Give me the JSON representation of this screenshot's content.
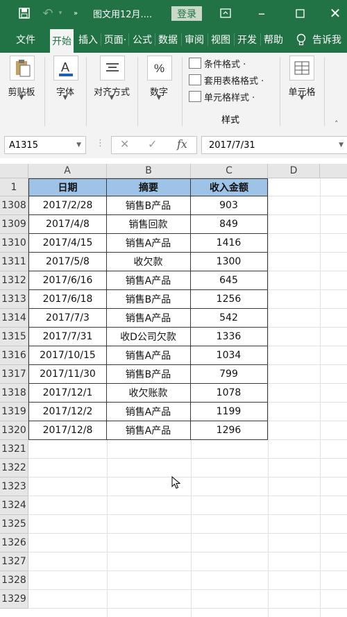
{
  "titlebar": {
    "save_icon": "save-icon",
    "undo_icon": "undo-icon",
    "more_icon": "customize-quick-access-icon",
    "title": "图文用12月....",
    "login": "登录",
    "icons": [
      "ribbon-display-options-icon",
      "minimize-icon",
      "maximize-icon",
      "close-icon"
    ],
    "bg_color": "#217346"
  },
  "tabs": [
    "文件",
    "开始",
    "插入",
    "页面·",
    "公式",
    "数据",
    "审阅",
    "视图",
    "开发",
    "帮助"
  ],
  "active_tab": "开始",
  "tell_me": "告诉我",
  "ribbon": {
    "clipboard": "剪贴板",
    "font": "字体",
    "alignment": "对齐方式",
    "number": "数字",
    "conditional": "条件格式 ·",
    "table_format": "套用表格格式 ·",
    "cell_styles": "单元格样式 ·",
    "styles_group": "样式",
    "cells": "单元格"
  },
  "formula_bar": {
    "name_box": "A1315",
    "formula": "2017/7/31",
    "cancel": "✕",
    "enter": "✓",
    "fx": "fx"
  },
  "columns": [
    "A",
    "B",
    "C",
    "D"
  ],
  "headers": [
    "日期",
    "摘要",
    "收入金额"
  ],
  "header_row": "1",
  "rows": [
    {
      "row": "1308",
      "date": "2017/2/28",
      "desc": "销售B产品",
      "amount": "903"
    },
    {
      "row": "1309",
      "date": "2017/4/8",
      "desc": "销售回款",
      "amount": "849"
    },
    {
      "row": "1310",
      "date": "2017/4/15",
      "desc": "销售A产品",
      "amount": "1416"
    },
    {
      "row": "1311",
      "date": "2017/5/8",
      "desc": "收欠款",
      "amount": "1300"
    },
    {
      "row": "1312",
      "date": "2017/6/16",
      "desc": "销售A产品",
      "amount": "645"
    },
    {
      "row": "1313",
      "date": "2017/6/18",
      "desc": "销售B产品",
      "amount": "1256"
    },
    {
      "row": "1314",
      "date": "2017/7/3",
      "desc": "销售A产品",
      "amount": "542"
    },
    {
      "row": "1315",
      "date": "2017/7/31",
      "desc": "收D公司欠款",
      "amount": "1336"
    },
    {
      "row": "1316",
      "date": "2017/10/15",
      "desc": "销售A产品",
      "amount": "1034"
    },
    {
      "row": "1317",
      "date": "2017/11/30",
      "desc": "销售B产品",
      "amount": "799"
    },
    {
      "row": "1318",
      "date": "2017/12/1",
      "desc": "收欠账款",
      "amount": "1078"
    },
    {
      "row": "1319",
      "date": "2017/12/2",
      "desc": "销售A产品",
      "amount": "1199"
    },
    {
      "row": "1320",
      "date": "2017/12/8",
      "desc": "销售A产品",
      "amount": "1296"
    }
  ],
  "empty_rows": [
    "1321",
    "1322",
    "1323",
    "1324",
    "1325",
    "1326",
    "1327",
    "1328",
    "1329"
  ],
  "header_fill": "#9dc3e6"
}
